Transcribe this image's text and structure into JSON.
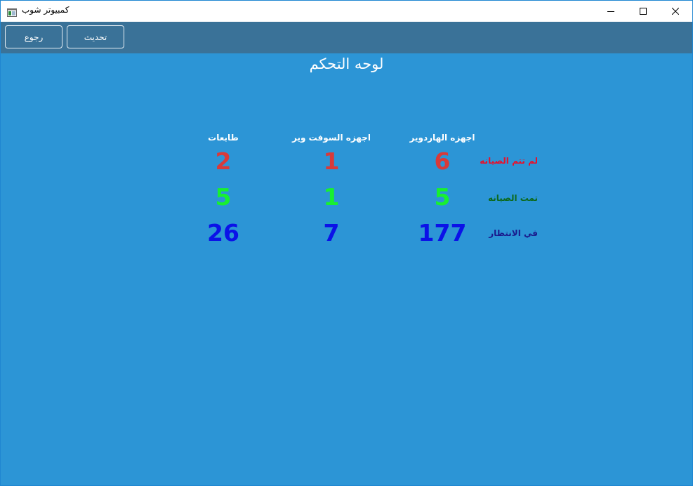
{
  "window": {
    "title": "كمبيوتر شوب",
    "icon": "app-window-icon",
    "controls": [
      "minimize-icon",
      "maximize-icon",
      "close-icon"
    ]
  },
  "toolbar": {
    "back_label": "رجوع",
    "refresh_label": "تحديث"
  },
  "dashboard": {
    "title": "لوحه التحكم",
    "columns": [
      "اجهزه الهاردوير",
      "اجهزه السوفت وير",
      "طابعات"
    ],
    "rows": [
      {
        "label": "لم تتم الصيانه",
        "label_color": "#e8102a",
        "value_color": "#d83a3a",
        "values": [
          "6",
          "1",
          "2"
        ]
      },
      {
        "label": "تمت الصيانه",
        "label_color": "#0c6a1e",
        "value_color": "#18f030",
        "values": [
          "5",
          "1",
          "5"
        ]
      },
      {
        "label": "في الانتظار",
        "label_color": "#1a1a8c",
        "value_color": "#0b12e8",
        "values": [
          "177",
          "7",
          "26"
        ]
      }
    ]
  },
  "colors": {
    "content_background": "#2c95d6",
    "toolbar_background": "#3a7298",
    "window_border": "#1f86d1"
  }
}
